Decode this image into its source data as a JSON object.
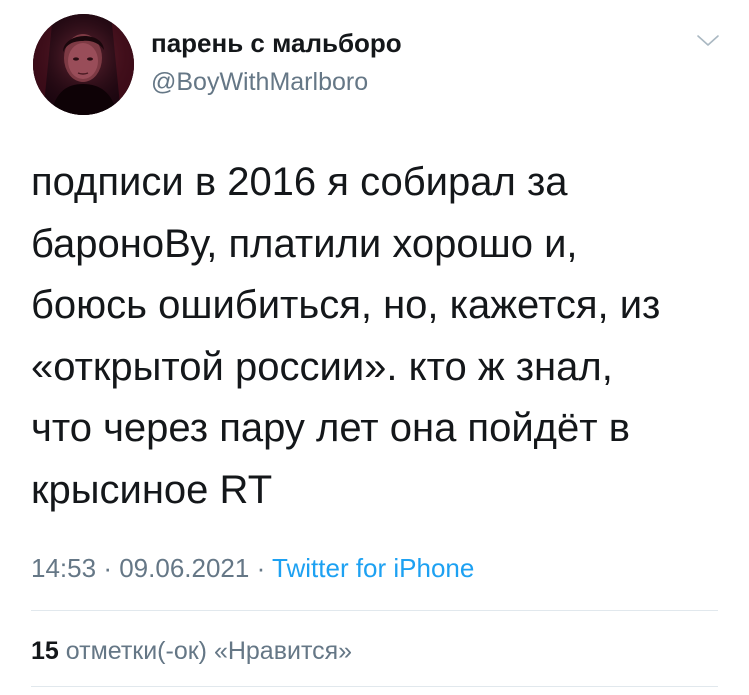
{
  "tweet": {
    "author": {
      "display_name": "парень с мальборо",
      "handle": "@BoyWithMarlboro",
      "avatar": "avatar-photo"
    },
    "text": "подписи в 2016 я собирал за\nбароноВу, платили хорошо и,\nбоюсь ошибиться, но, кажется, из\n«открытой россии». кто ж знал,\nчто через пару лет она пойдёт в\nкрысиное RT",
    "time": "14:53",
    "date": "09.06.2021",
    "separator": "·",
    "source": "Twitter for iPhone",
    "likes": {
      "count": "15",
      "label": "отметки(-ок) «Нравится»"
    },
    "menu_icon": "chevron-down-icon"
  },
  "colors": {
    "text": "#14171a",
    "secondary": "#657786",
    "link": "#1da1f2",
    "divider": "#e1e8ed"
  }
}
